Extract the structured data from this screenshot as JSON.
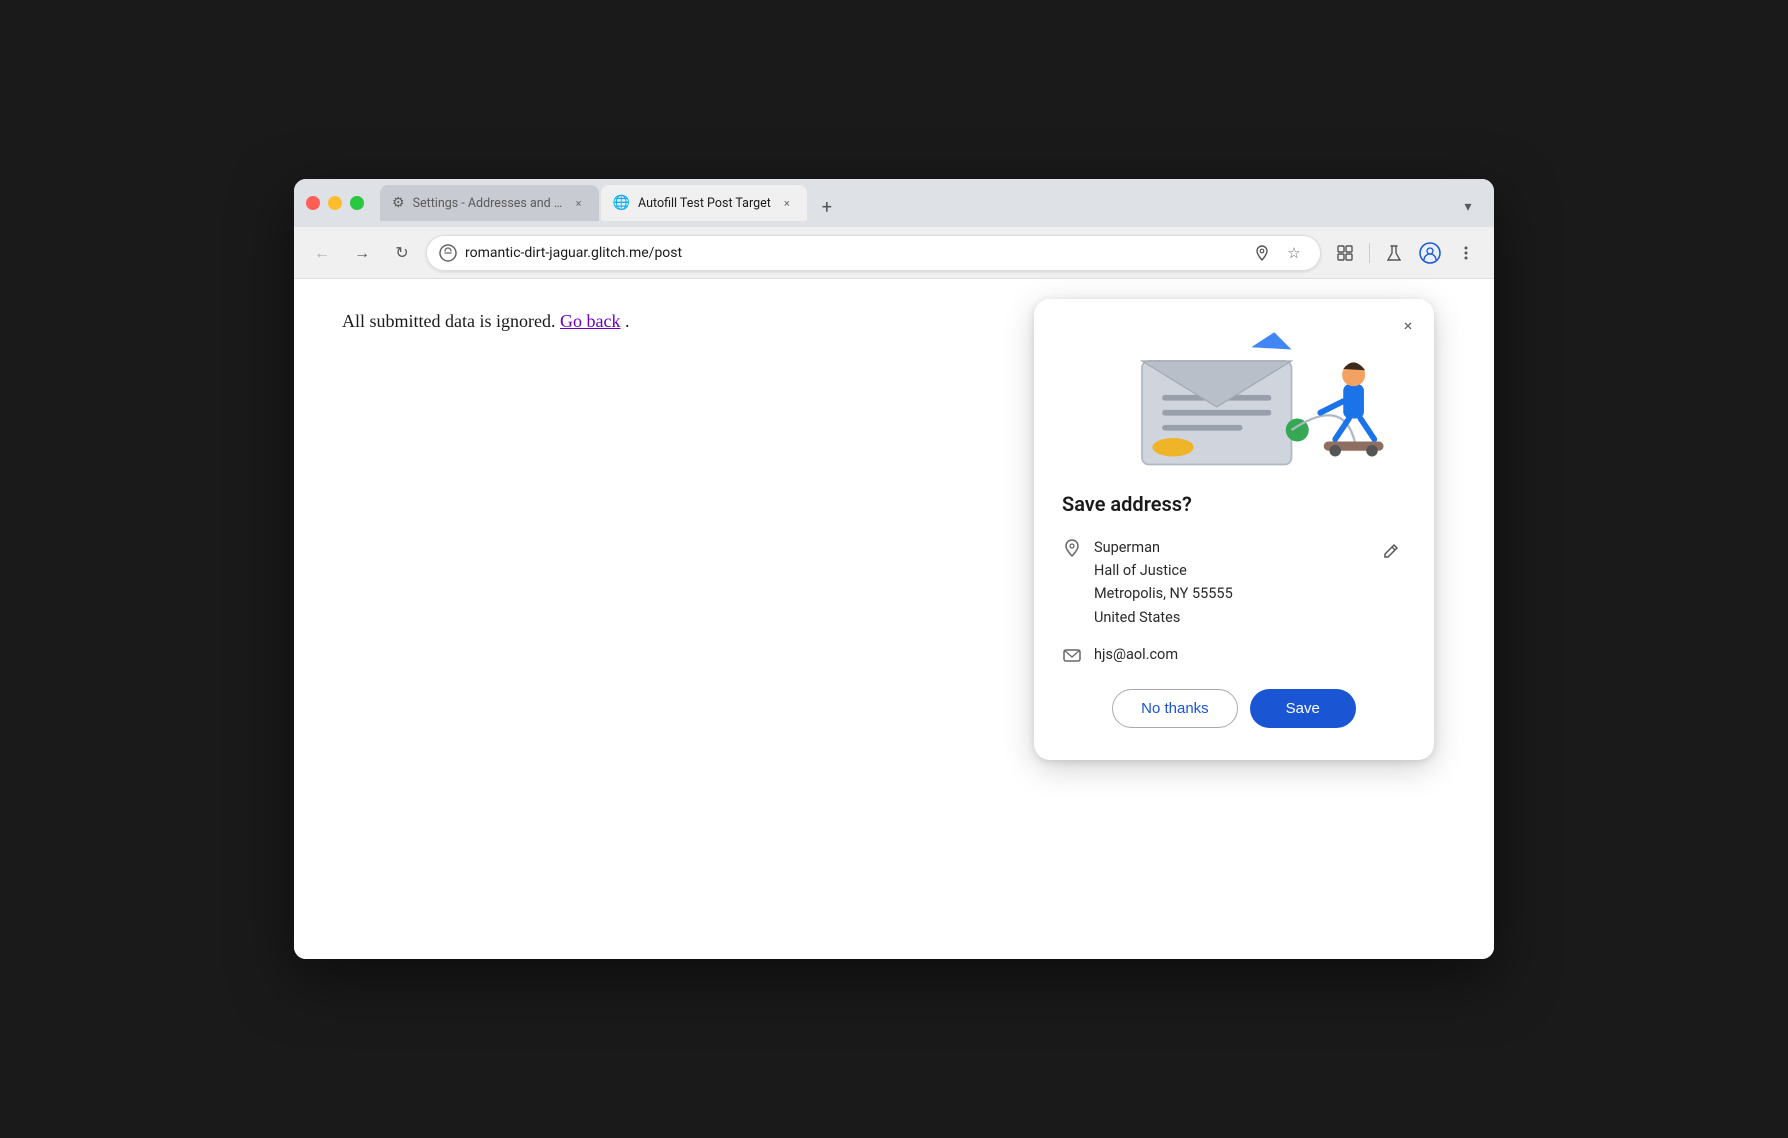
{
  "browser": {
    "tabs": [
      {
        "id": "tab-settings",
        "label": "Settings - Addresses and mo",
        "icon": "gear",
        "active": false
      },
      {
        "id": "tab-autofill",
        "label": "Autofill Test Post Target",
        "icon": "globe",
        "active": true
      }
    ],
    "new_tab_label": "+",
    "chevron_label": "▾"
  },
  "omnibar": {
    "back_label": "←",
    "forward_label": "→",
    "reload_label": "↻",
    "url": "romantic-dirt-jaguar.glitch.me/post",
    "location_icon": "📍",
    "star_label": "☆",
    "extensions_label": "🧩",
    "labs_label": "⚗",
    "profile_label": "👤",
    "menu_label": "⋮"
  },
  "page": {
    "body_text": "All submitted data is ignored.",
    "link_text": "Go back",
    "period": "."
  },
  "dialog": {
    "title": "Save address?",
    "close_label": "×",
    "address": {
      "name": "Superman",
      "street": "Hall of Justice",
      "city_state_zip": "Metropolis, NY 55555",
      "country": "United States"
    },
    "email": "hjs@aol.com",
    "no_thanks_label": "No thanks",
    "save_label": "Save"
  },
  "colors": {
    "accent_blue": "#1a55d4",
    "link_purple": "#6b00c0",
    "tab_active_bg": "#f0f0f0",
    "tab_inactive_bg": "#c8ccd2"
  }
}
